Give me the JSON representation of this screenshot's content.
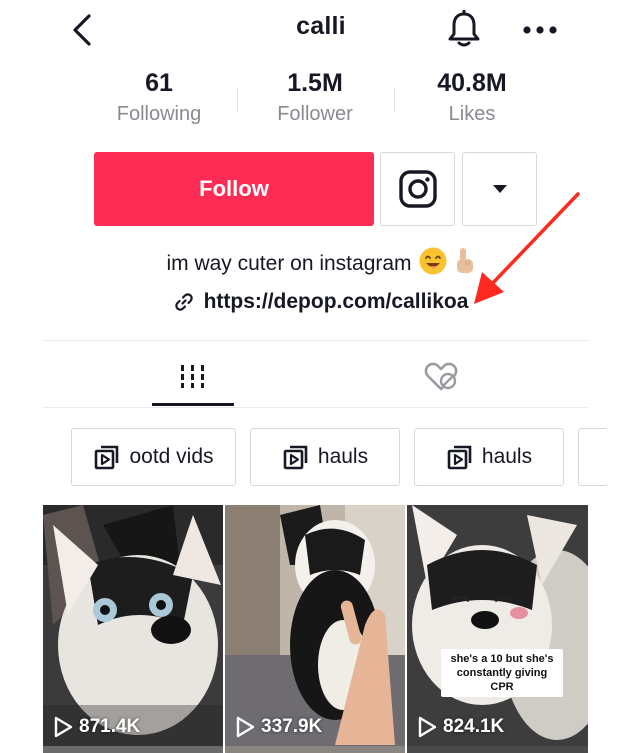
{
  "header": {
    "title": "calli"
  },
  "stats": [
    {
      "value": "61",
      "label": "Following"
    },
    {
      "value": "1.5M",
      "label": "Follower"
    },
    {
      "value": "40.8M",
      "label": "Likes"
    }
  ],
  "actions": {
    "follow_label": "Follow"
  },
  "bio": {
    "text": "im way cuter on instagram",
    "link": "https://depop.com/callikoa"
  },
  "playlists": [
    {
      "label": "ootd vids"
    },
    {
      "label": "hauls"
    },
    {
      "label": "hauls"
    }
  ],
  "videos": [
    {
      "views": "871.4K",
      "caption": ""
    },
    {
      "views": "337.9K",
      "caption": ""
    },
    {
      "views": "824.1K",
      "caption": "she's a 10 but she's constantly giving CPR"
    }
  ],
  "colors": {
    "accent": "#fe2c55",
    "annotation_arrow": "#ff2a1f"
  }
}
